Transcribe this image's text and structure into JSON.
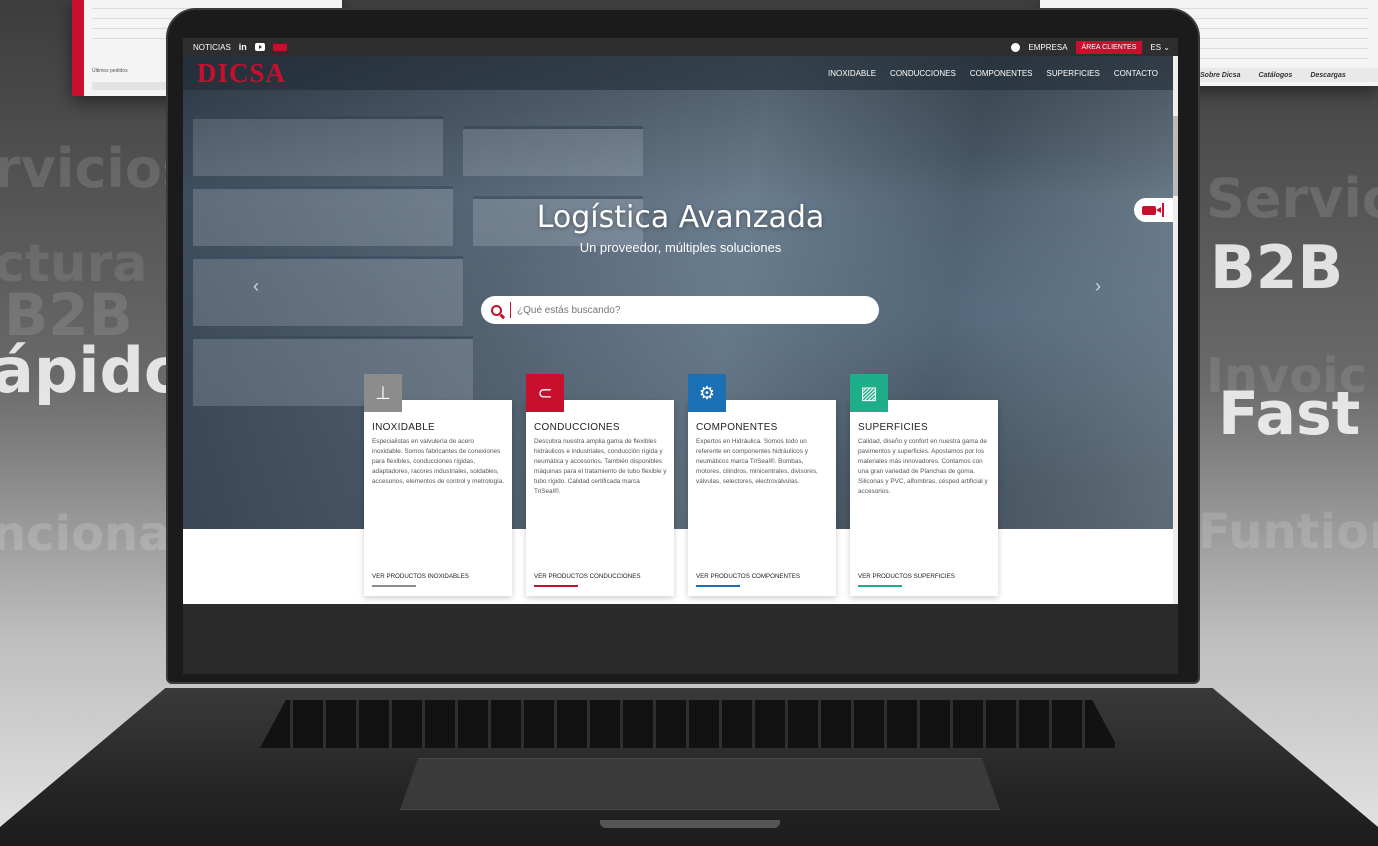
{
  "background": {
    "left_words": [
      "rvicios",
      "ctura",
      "B2B",
      "ápido",
      "ncional"
    ],
    "right_words": [
      "Servic",
      "B2B",
      "Invoic",
      "Fast",
      "Funtion"
    ]
  },
  "bg_panel_right": {
    "nav": [
      "Sobre Dicsa",
      "Catálogos",
      "Descargas"
    ]
  },
  "bg_panel_left": {
    "label": "Últimos pedidos"
  },
  "topbar": {
    "news": "NOTICIAS",
    "linkedin": "in",
    "company": "EMPRESA",
    "client_area": "ÁREA CLIENTES",
    "lang": "ES"
  },
  "navbar": {
    "logo": "DICSA",
    "menu": [
      "INOXIDABLE",
      "CONDUCCIONES",
      "COMPONENTES",
      "SUPERFICIES",
      "CONTACTO"
    ]
  },
  "hero": {
    "title": "Logística Avanzada",
    "subtitle": "Un proveedor, múltiples soluciones",
    "search_placeholder": "¿Qué estás buscando?"
  },
  "cards": [
    {
      "title": "INOXIDABLE",
      "text": "Especialistas en valvulería de acero inoxidable. Somos fabricantes de conexiones para flexibles, conducciones rígidas, adaptadores, racores industriales, soldables, accesorios, elementos de control y metrología.",
      "link": "VER PRODUCTOS INOXIDABLES",
      "color": "#8c8c8c",
      "icon": "valve-icon"
    },
    {
      "title": "CONDUCCIONES",
      "text": "Descubra nuestra amplia gama de flexibles hidráulicos e industriales, conducción rígida y neumática y accesorios. También disponibles máquinas para el tratamiento de tubo flexible y tubo rígido. Calidad certificada marca TriSeal®.",
      "link": "VER PRODUCTOS CONDUCCIONES",
      "color": "#c8102e",
      "icon": "hose-icon"
    },
    {
      "title": "COMPONENTES",
      "text": "Expertos en Hidráulica. Somos todo un referente en componentes hidráulicos y neumáticos marca TriSeal®. Bombas, motores, cilindros, minicentrales, divisores, válvulas, selectores, electroválvulas.",
      "link": "VER PRODUCTOS COMPONENTES",
      "color": "#1a6fb5",
      "icon": "pump-icon"
    },
    {
      "title": "SUPERFICIES",
      "text": "Calidad, diseño y confort en nuestra gama de pavimentos y superficies. Apostamos por los materiales más innovadores. Contamos con una gran variedad de Planchas de goma, Siliconas y PVC, alfombras, césped artificial y accesorios.",
      "link": "VER PRODUCTOS SUPERFICIES",
      "color": "#1fae8a",
      "icon": "surface-icon"
    }
  ]
}
